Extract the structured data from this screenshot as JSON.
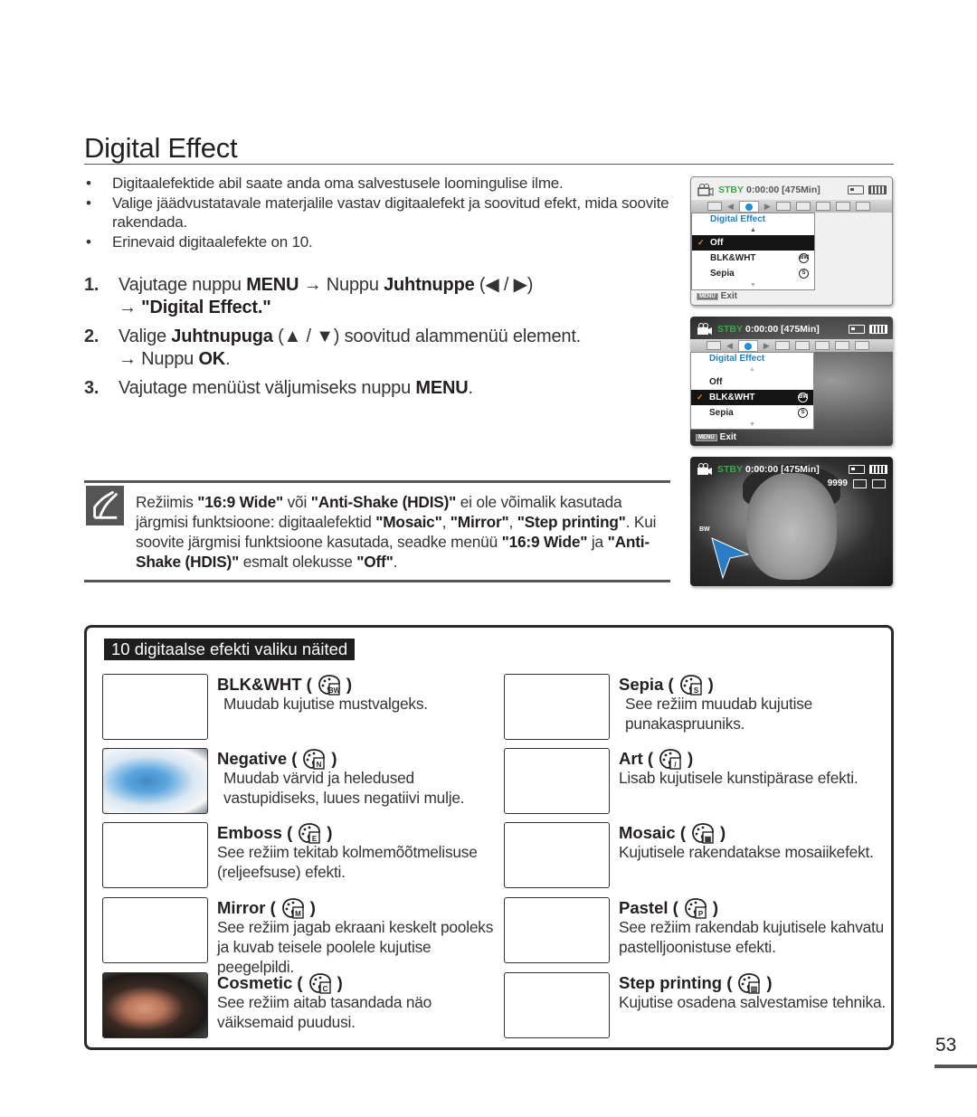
{
  "page": {
    "title": "Digital Effect",
    "number": "53"
  },
  "bullets": [
    "Digitaalefektide abil saate anda oma salvestusele loomingulise ilme.",
    "Valige jäädvustatavale materjalile vastav digitaalefekt ja soovitud efekt, mida soovite rakendada.",
    "Erinevaid digitaalefekte on 10."
  ],
  "steps": [
    {
      "num": "1.",
      "parts": [
        "Vajutage nuppu ",
        "MENU",
        " → Nuppu ",
        "Juhtnuppe",
        " (◀ / ▶)"
      ],
      "line2_arrow": "→ ",
      "line2_bold": "\"Digital Effect.\""
    },
    {
      "num": "2.",
      "parts": [
        "Valige ",
        "Juhtnupuga",
        " (▲ / ▼) soovitud alammenüü element."
      ],
      "line2_arrow": "→ Nuppu ",
      "line2_bold": "OK",
      "line2_tail": "."
    },
    {
      "num": "3.",
      "parts": [
        "Vajutage menüüst väljumiseks nuppu ",
        "MENU",
        "."
      ]
    }
  ],
  "note": {
    "icon": "note-pencil-icon",
    "segments": [
      [
        "Režiimis ",
        false
      ],
      [
        "\"16:9 Wide\"",
        true
      ],
      [
        " või ",
        false
      ],
      [
        "\"Anti-Shake (HDIS)\"",
        true
      ],
      [
        " ei ole võimalik kasutada järgmisi funktsioone: digitaalefektid ",
        false
      ],
      [
        "\"Mosaic\"",
        true
      ],
      [
        ", ",
        false
      ],
      [
        "\"Mirror\"",
        true
      ],
      [
        ", ",
        false
      ],
      [
        "\"Step printing\"",
        true
      ],
      [
        ". Kui soovite järgmisi funktsioone kasutada, seadke menüü ",
        false
      ],
      [
        "\"16:9 Wide\"",
        true
      ],
      [
        " ja ",
        false
      ],
      [
        "\"Anti-Shake (HDIS)\"",
        true
      ],
      [
        " esmalt olekusse ",
        false
      ],
      [
        "\"Off\"",
        true
      ],
      [
        ".",
        false
      ]
    ]
  },
  "camera_screens": [
    {
      "status": "STBY",
      "time": "0:00:00",
      "remaining": "[475Min]",
      "menu_title": "Digital Effect",
      "items": [
        {
          "label": "Off",
          "selected": true,
          "icon": ""
        },
        {
          "label": "BLK&WHT",
          "selected": false,
          "icon": "BW"
        },
        {
          "label": "Sepia",
          "selected": false,
          "icon": "S"
        }
      ],
      "exit_key": "MENU",
      "exit_label": "Exit"
    },
    {
      "status": "STBY",
      "time": "0:00:00",
      "remaining": "[475Min]",
      "menu_title": "Digital Effect",
      "items": [
        {
          "label": "Off",
          "selected": false,
          "icon": ""
        },
        {
          "label": "BLK&WHT",
          "selected": true,
          "icon": "BW"
        },
        {
          "label": "Sepia",
          "selected": false,
          "icon": "S"
        }
      ],
      "exit_key": "MENU",
      "exit_label": "Exit"
    },
    {
      "status": "STBY",
      "time": "0:00:00",
      "remaining": "[475Min]",
      "counter": "9999",
      "effect_indicator": "BW"
    }
  ],
  "examples": {
    "heading": "10 digitaalse efekti valiku näited",
    "items": [
      {
        "name": "BLK&WHT (",
        "close": ")",
        "icon_letter": "BW",
        "icon": "bw-effect-icon",
        "desc": "Muudab kujutise mustvalgeks.",
        "thumb": "blank"
      },
      {
        "name": "Sepia (",
        "close": ")",
        "icon_letter": "S",
        "icon": "sepia-effect-icon",
        "desc": "See režiim muudab kujutise punakaspruuniks.",
        "thumb": "blank"
      },
      {
        "name": "Negative (",
        "close": ")",
        "icon_letter": "N",
        "icon": "negative-effect-icon",
        "desc": "Muudab värvid ja heledused vastupidiseks, luues negatiivi mulje.",
        "thumb": "negative"
      },
      {
        "name": "Art (",
        "close": ")",
        "icon_letter": "/",
        "icon": "art-effect-icon",
        "desc": "Lisab kujutisele kunstipärase efekti.",
        "thumb": "blank"
      },
      {
        "name": "Emboss (",
        "close": ")",
        "icon_letter": "E",
        "icon": "emboss-effect-icon",
        "desc": "See režiim tekitab kolmemõõtmelisuse (reljeefsuse) efekti.",
        "thumb": "blank"
      },
      {
        "name": "Mosaic (",
        "close": ")",
        "icon_letter": "▦",
        "icon": "mosaic-effect-icon",
        "desc": "Kujutisele rakendatakse mosaiikefekt.",
        "thumb": "blank"
      },
      {
        "name": "Mirror (",
        "close": ")",
        "icon_letter": "M",
        "icon": "mirror-effect-icon",
        "desc": "See režiim jagab ekraani keskelt pooleks ja kuvab teisele poolele kujutise peegelpildi.",
        "thumb": "blank"
      },
      {
        "name": "Pastel (",
        "close": ")",
        "icon_letter": "P",
        "icon": "pastel-effect-icon",
        "desc": "See režiim rakendab kujutisele kahvatu pastelljoonistuse efekti.",
        "thumb": "blank"
      },
      {
        "name": "Cosmetic (",
        "close": ")",
        "icon_letter": "C",
        "icon": "cosmetic-effect-icon",
        "desc": "See režiim aitab tasandada näo väiksemaid puudusi.",
        "thumb": "cosmetic"
      },
      {
        "name": "Step printing (",
        "close": ")",
        "icon_letter": "▥",
        "icon": "step-printing-effect-icon",
        "desc": "Kujutise osadena salvestamise tehnika.",
        "thumb": "blank"
      }
    ]
  }
}
